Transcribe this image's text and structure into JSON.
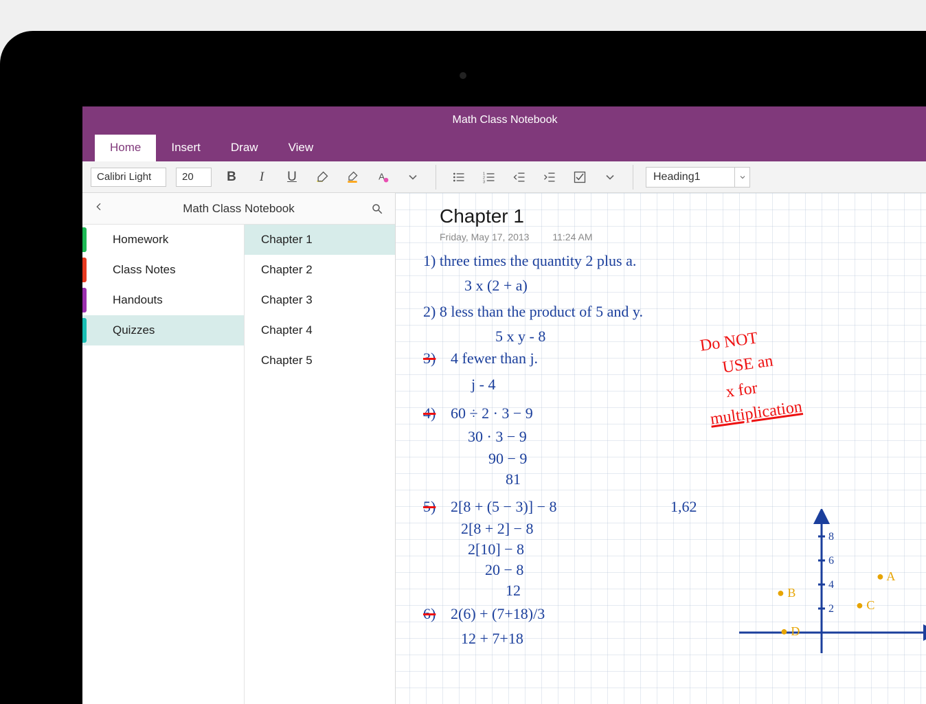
{
  "app_title": "Math Class Notebook",
  "ribbon": {
    "tabs": [
      "Home",
      "Insert",
      "Draw",
      "View"
    ],
    "active": 0
  },
  "toolbar": {
    "font_name": "Calibri Light",
    "font_size": "20",
    "style": "Heading1"
  },
  "nav": {
    "title": "Math Class Notebook",
    "sections": [
      {
        "label": "Homework",
        "color": "#1db954"
      },
      {
        "label": "Class Notes",
        "color": "#e6391f"
      },
      {
        "label": "Handouts",
        "color": "#9b2fae"
      },
      {
        "label": "Quizzes",
        "color": "#17bdb3",
        "selected": true
      }
    ],
    "pages": [
      {
        "label": "Chapter 1",
        "selected": true
      },
      {
        "label": "Chapter 2"
      },
      {
        "label": "Chapter 3"
      },
      {
        "label": "Chapter 4"
      },
      {
        "label": "Chapter 5"
      }
    ]
  },
  "page": {
    "title": "Chapter 1",
    "date": "Friday, May 17, 2013",
    "time": "11:24 AM"
  },
  "ink": {
    "q1_a": "1) three times the quantity 2 plus a.",
    "q1_b": "3 x (2 + a)",
    "q2_a": "2) 8 less than the product of 5 and y.",
    "q2_b": "5 x y - 8",
    "q3_n": "3)",
    "q3_a": "4 fewer than j.",
    "q3_b": "j - 4",
    "q4_n": "4)",
    "q4_a": "60 ÷ 2 · 3 − 9",
    "q4_b": "30 · 3 − 9",
    "q4_c": "90 − 9",
    "q4_d": "81",
    "q5_n": "5)",
    "q5_a": "2[8 + (5 − 3)] − 8",
    "q5_b": "2[8 + 2] − 8",
    "q5_c": "2[10] − 8",
    "q5_d": "20 − 8",
    "q5_e": "12",
    "q6_n": "6)",
    "q6_a": "2(6) + (7+18)/3",
    "q6_b": "12 + 7+18",
    "note1": "Do NOT",
    "note2": "USE an",
    "note3": "x for",
    "note4": "multiplication",
    "side_num": "1,62",
    "axis_ticks": [
      "8",
      "6",
      "4",
      "2"
    ],
    "pts": {
      "A": "A",
      "B": "B",
      "C": "C",
      "D": "D"
    }
  }
}
